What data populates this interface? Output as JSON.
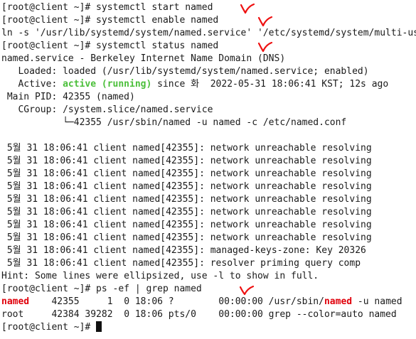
{
  "terminal": {
    "lines": [
      "[root@client ~]# systemctl start named",
      "[root@client ~]# systemctl enable named",
      "ln -s '/usr/lib/systemd/system/named.service' '/etc/systemd/system/multi-user.target.wants/named.service'",
      "[root@client ~]# systemctl status named",
      "named.service - Berkeley Internet Name Domain (DNS)",
      "   Loaded: loaded (/usr/lib/systemd/system/named.service; enabled)",
      "",
      " Main PID: 42355 (named)",
      "   CGroup: /system.slice/named.service",
      "           └─42355 /usr/sbin/named -u named -c /etc/named.conf",
      "",
      " 5월 31 18:06:41 client named[42355]: network unreachable resolving",
      " 5월 31 18:06:41 client named[42355]: network unreachable resolving",
      " 5월 31 18:06:41 client named[42355]: network unreachable resolving",
      " 5월 31 18:06:41 client named[42355]: network unreachable resolving",
      " 5월 31 18:06:41 client named[42355]: network unreachable resolving",
      " 5월 31 18:06:41 client named[42355]: network unreachable resolving",
      " 5월 31 18:06:41 client named[42355]: network unreachable resolving",
      " 5월 31 18:06:41 client named[42355]: network unreachable resolving",
      " 5월 31 18:06:41 client named[42355]: managed-keys-zone: Key 20326",
      " 5월 31 18:06:41 client named[42355]: resolver priming query comp",
      "Hint: Some lines were ellipsized, use -l to show in full.",
      "[root@client ~]# ps -ef | grep named"
    ],
    "active_line": {
      "prefix": "   Active: ",
      "status": "active (running)",
      "suffix": " since 화  2022-05-31 18:06:41 KST; 12s ago"
    },
    "ps_rows": [
      {
        "uid": "named",
        "rest": "    42355     1  0 18:06 ?        00:00:00 /usr/sbin/",
        "cmd_highlight": "named",
        "cmd_tail": " -u named"
      },
      {
        "uid": "root",
        "rest": "     42384 39282  0 18:06 pts/0    00:00:00 grep --color=auto named",
        "cmd_highlight": "",
        "cmd_tail": ""
      }
    ],
    "prompt": "[root@client ~]# ",
    "colors": {
      "background": "#ffffff",
      "text": "#1a1a1a",
      "active": "#4bbf3a",
      "highlight": "#e0000b",
      "annotation": "#ee1111"
    }
  }
}
